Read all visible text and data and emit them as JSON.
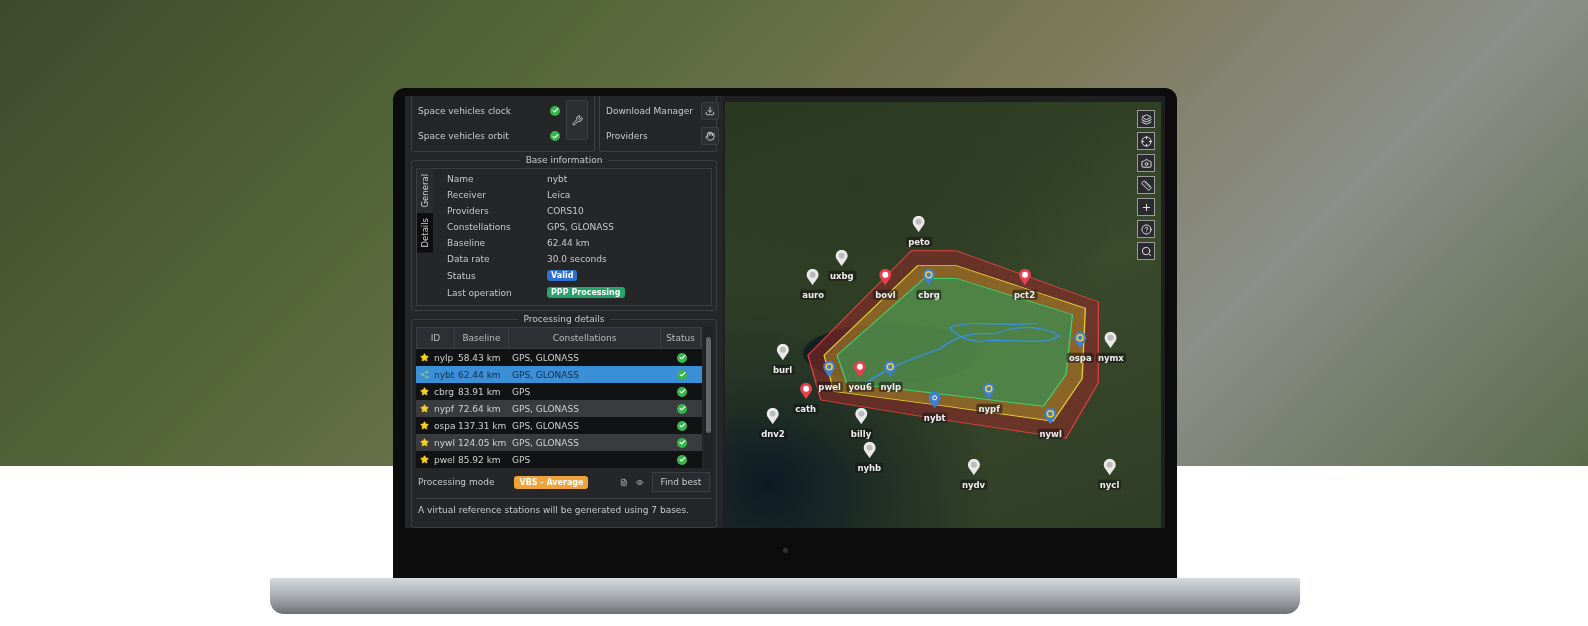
{
  "status_checks": [
    {
      "label": "Space vehicles clock",
      "ok": true
    },
    {
      "label": "Space vehicles orbit",
      "ok": true
    }
  ],
  "tools": [
    {
      "label": "Download Manager",
      "kind": "download"
    },
    {
      "label": "Providers",
      "kind": "providers"
    }
  ],
  "base_information": {
    "title": "Base information",
    "tabs": [
      {
        "label": "General",
        "selected": false
      },
      {
        "label": "Details",
        "selected": true
      }
    ],
    "fields": [
      {
        "label": "Name",
        "value": "nybt",
        "kind": "text"
      },
      {
        "label": "Receiver",
        "value": "Leica",
        "kind": "text"
      },
      {
        "label": "Providers",
        "value": "CORS10",
        "kind": "text"
      },
      {
        "label": "Constellations",
        "value": "GPS, GLONASS",
        "kind": "text"
      },
      {
        "label": "Baseline",
        "value": "62.44 km",
        "kind": "text"
      },
      {
        "label": "Data rate",
        "value": "30.0 seconds",
        "kind": "text"
      },
      {
        "label": "Status",
        "value": "Valid",
        "kind": "badge",
        "color": "#2f6fd0"
      },
      {
        "label": "Last operation",
        "value": "PPP Processing",
        "kind": "badge",
        "color": "#27a46a"
      }
    ]
  },
  "processing_details": {
    "title": "Processing details",
    "columns": [
      "ID",
      "Baseline",
      "Constellations",
      "Status"
    ],
    "rows": [
      {
        "kind": "star",
        "id": "nylp",
        "baseline": "58.43 km",
        "constellations": "GPS, GLONASS",
        "ok": true,
        "selected": false
      },
      {
        "kind": "share",
        "id": "nybt",
        "baseline": "62.44 km",
        "constellations": "GPS, GLONASS",
        "ok": true,
        "selected": true
      },
      {
        "kind": "star",
        "id": "cbrg",
        "baseline": "83.91 km",
        "constellations": "GPS",
        "ok": true,
        "selected": false
      },
      {
        "kind": "star",
        "id": "nypf",
        "baseline": "72.64 km",
        "constellations": "GPS, GLONASS",
        "ok": true,
        "selected": false
      },
      {
        "kind": "star",
        "id": "ospa",
        "baseline": "137.31 km",
        "constellations": "GPS, GLONASS",
        "ok": true,
        "selected": false
      },
      {
        "kind": "star",
        "id": "nywl",
        "baseline": "124.05 km",
        "constellations": "GPS, GLONASS",
        "ok": true,
        "selected": false
      },
      {
        "kind": "star",
        "id": "pwel",
        "baseline": "85.92 km",
        "constellations": "GPS",
        "ok": true,
        "selected": false
      }
    ]
  },
  "processing_mode": {
    "label": "Processing mode",
    "value": "VBS - Average",
    "button": "Find best"
  },
  "note": "A virtual reference stations will be generated using 7 bases.",
  "map": {
    "stations": [
      {
        "name": "peto",
        "kind": "reference"
      },
      {
        "name": "uxbg",
        "kind": "reference"
      },
      {
        "name": "auro",
        "kind": "reference"
      },
      {
        "name": "bovl",
        "kind": "rover"
      },
      {
        "name": "cbrg",
        "kind": "selected"
      },
      {
        "name": "pct2",
        "kind": "rover"
      },
      {
        "name": "ospa",
        "kind": "selected"
      },
      {
        "name": "nymx",
        "kind": "reference"
      },
      {
        "name": "burl",
        "kind": "reference"
      },
      {
        "name": "pwel",
        "kind": "selected"
      },
      {
        "name": "you6",
        "kind": "rover"
      },
      {
        "name": "nylp",
        "kind": "selected"
      },
      {
        "name": "cath",
        "kind": "rover"
      },
      {
        "name": "nypf",
        "kind": "selected"
      },
      {
        "name": "nybt",
        "kind": "base"
      },
      {
        "name": "dnv2",
        "kind": "reference"
      },
      {
        "name": "billy",
        "kind": "reference"
      },
      {
        "name": "nywl",
        "kind": "selected"
      },
      {
        "name": "nyhb",
        "kind": "reference"
      },
      {
        "name": "nydv",
        "kind": "reference"
      },
      {
        "name": "nycl",
        "kind": "reference"
      }
    ]
  }
}
